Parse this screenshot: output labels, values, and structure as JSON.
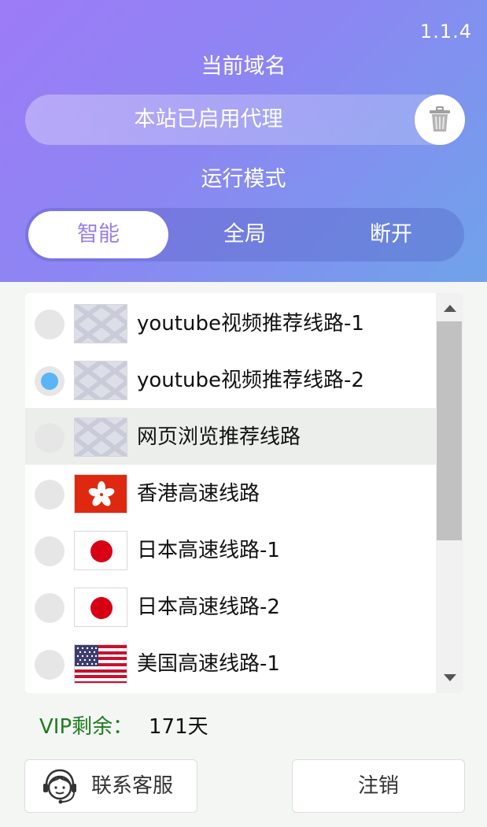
{
  "header": {
    "version": "1.1.4",
    "domain_label": "当前域名",
    "domain_value": "本站已启用代理",
    "delete_icon": "trash-icon",
    "mode_label": "运行模式",
    "modes": [
      "智能",
      "全局",
      "断开"
    ],
    "active_mode": "智能"
  },
  "colors": {
    "gradient_start": "#9d7bf7",
    "gradient_end": "#6fa3ea",
    "active_mode_text": "#9a7fe8",
    "radio_checked": "#5ab4f5",
    "vip_label": "#1e7d1e"
  },
  "servers": {
    "items": [
      {
        "label": "youtube视频推荐线路-1",
        "flag": "placeholder-flag-icon",
        "selected": false
      },
      {
        "label": "youtube视频推荐线路-2",
        "flag": "placeholder-flag-icon",
        "selected": true
      },
      {
        "label": "网页浏览推荐线路",
        "flag": "placeholder-flag-icon",
        "selected": false
      },
      {
        "label": "香港高速线路",
        "flag": "hong-kong-flag-icon",
        "selected": false
      },
      {
        "label": "日本高速线路-1",
        "flag": "japan-flag-icon",
        "selected": false
      },
      {
        "label": "日本高速线路-2",
        "flag": "japan-flag-icon",
        "selected": false
      },
      {
        "label": "美国高速线路-1",
        "flag": "usa-flag-icon",
        "selected": false
      }
    ]
  },
  "footer": {
    "vip_label": "VIP剩余：",
    "vip_days": "171天",
    "support_label": "联系客服",
    "support_icon": "customer-service-icon",
    "logout_label": "注销"
  }
}
